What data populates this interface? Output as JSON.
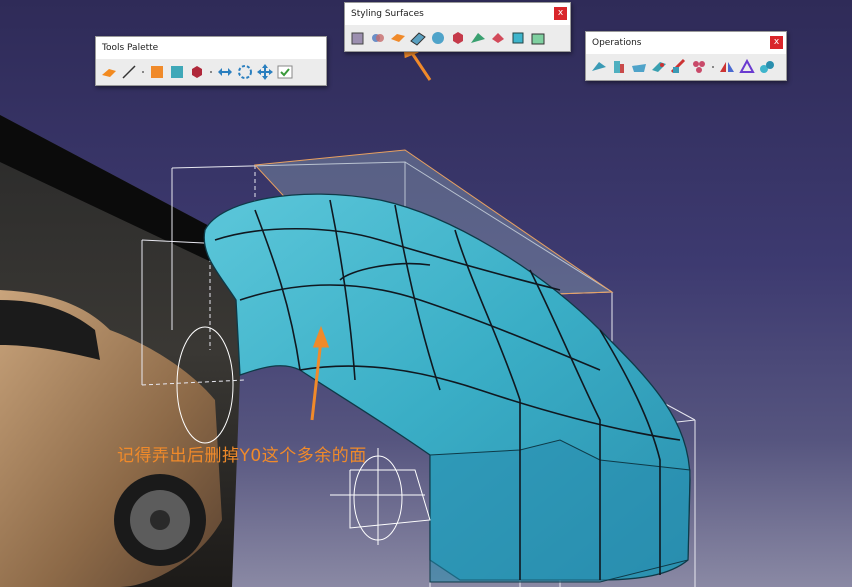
{
  "toolbars": {
    "tools_palette": {
      "title": "Tools Palette",
      "close": "x"
    },
    "styling_surfaces": {
      "title": "Styling Surfaces",
      "close": "x"
    },
    "operations": {
      "title": "Operations",
      "close": "x"
    }
  },
  "annotation": {
    "text": "记得弄出后删掉Y0这个多余的面",
    "color": "#f08a2a"
  },
  "colors": {
    "surface": "#3fb5cc",
    "background": "#3d3a70",
    "accent": "#f08a2a"
  }
}
